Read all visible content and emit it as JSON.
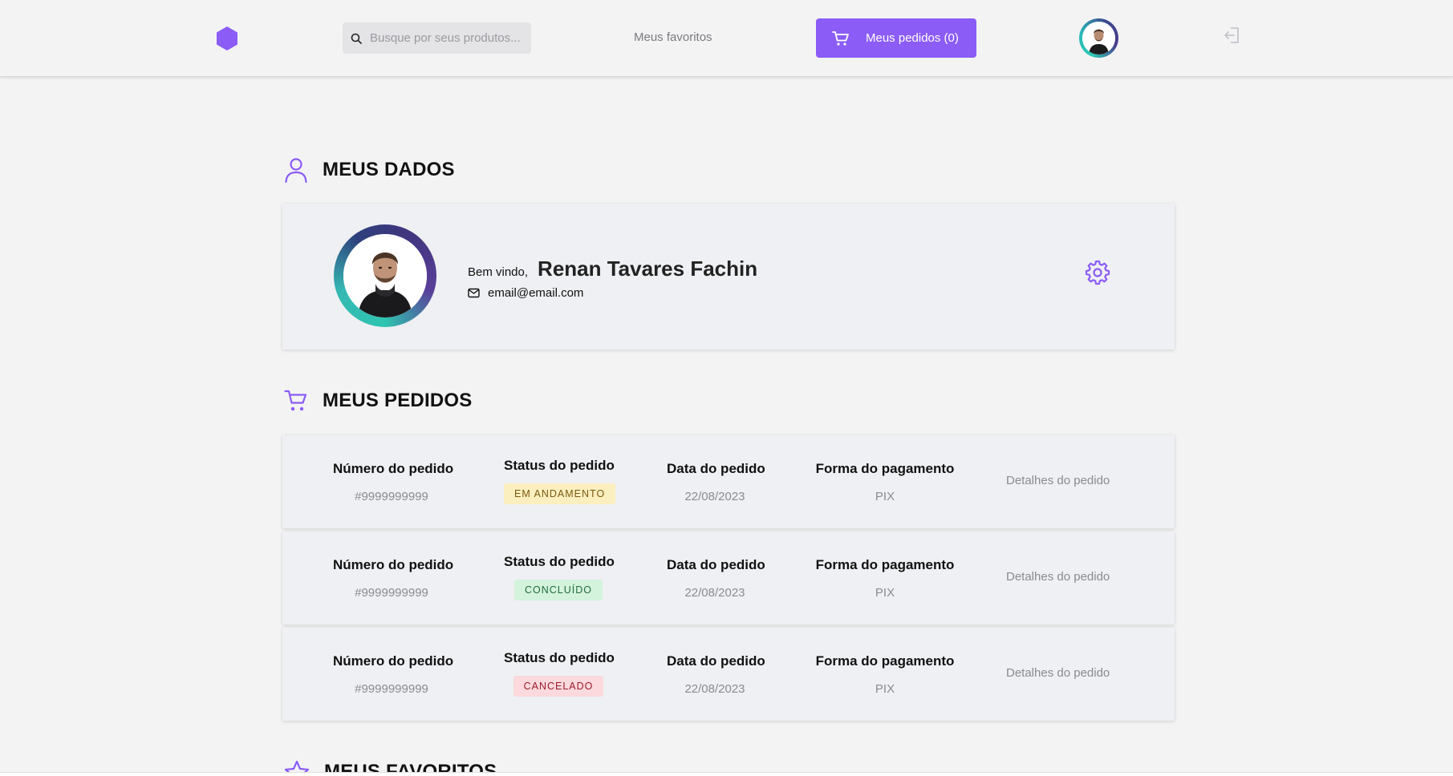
{
  "header": {
    "search_placeholder": "Busque por seus produtos...",
    "favorites_link": "Meus favoritos",
    "orders_button": "Meus pedidos (0)"
  },
  "profile": {
    "section_title": "MEUS DADOS",
    "welcome_label": "Bem vindo,",
    "name": "Renan Tavares Fachin",
    "email": "email@email.com"
  },
  "orders": {
    "section_title": "MEUS PEDIDOS",
    "headers": {
      "number": "Número do pedido",
      "status": "Status do pedido",
      "date": "Data do pedido",
      "payment": "Forma do pagamento"
    },
    "rows": [
      {
        "number": "#9999999999",
        "status": "EM ANDAMENTO",
        "date": "22/08/2023",
        "payment": "PIX",
        "details": "Detalhes do pedido"
      },
      {
        "number": "#9999999999",
        "status": "CONCLUÍDO",
        "date": "22/08/2023",
        "payment": "PIX",
        "details": "Detalhes do pedido"
      },
      {
        "number": "#9999999999",
        "status": "CANCELADO",
        "date": "22/08/2023",
        "payment": "PIX",
        "details": "Detalhes do pedido"
      }
    ]
  },
  "favorites": {
    "section_title": "MEUS FAVORITOS"
  },
  "colors": {
    "accent": "#8b5cf6",
    "status_in_progress_bg": "#fbefbf",
    "status_in_progress_fg": "#7a5a10",
    "status_done_bg": "#d4f3dc",
    "status_done_fg": "#226b3a",
    "status_canceled_bg": "#fbd9dc",
    "status_canceled_fg": "#9b1c2a"
  },
  "icons": [
    "hexagon-logo-icon",
    "search-icon",
    "cart-icon",
    "logout-icon",
    "user-icon",
    "mail-icon",
    "gear-icon",
    "star-icon"
  ]
}
